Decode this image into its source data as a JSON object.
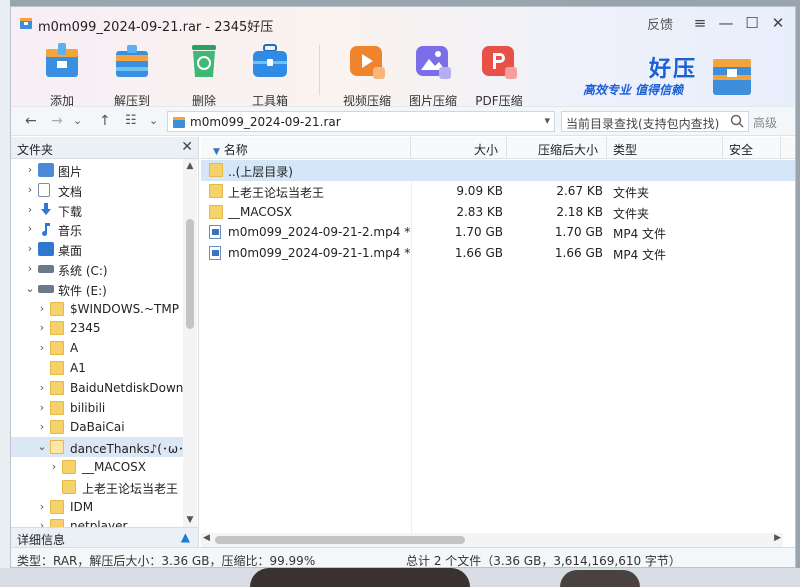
{
  "window": {
    "title": "m0m099_2024-09-21.rar - 2345好压",
    "feedback": "反馈",
    "menu": "≡",
    "minimize": "—",
    "maximize": "☐",
    "close": "✕"
  },
  "toolbar": {
    "items": [
      {
        "label": "添加",
        "color": "#3b8fe0"
      },
      {
        "label": "解压到",
        "color": "#3b8fe0"
      },
      {
        "label": "删除",
        "color": "#3fb874"
      },
      {
        "label": "工具箱",
        "color": "#2f8be6"
      },
      {
        "label": "视频压缩",
        "color": "#f0842c"
      },
      {
        "label": "图片压缩",
        "color": "#7b6ee8"
      },
      {
        "label": "PDF压缩",
        "color": "#e8504a"
      }
    ]
  },
  "brand": {
    "name": "好压",
    "slogan": "高效专业  值得信赖",
    "accent": "#1a5fd6"
  },
  "address": {
    "back": "←",
    "forward": "→",
    "dropdown": "⌄",
    "up": "↑",
    "view": "☷",
    "view_dropdown": "⌄",
    "path": "m0m099_2024-09-21.rar",
    "path_dropdown": "▾",
    "search_placeholder": "当前目录查找(支持包内查找)",
    "advanced": "高级"
  },
  "tree": {
    "header": "文件夹",
    "close": "✕",
    "nodes": [
      {
        "label": "图片",
        "arrow": "›",
        "icon": "pictures"
      },
      {
        "label": "文档",
        "arrow": "›",
        "icon": "documents"
      },
      {
        "label": "下载",
        "arrow": "›",
        "icon": "downloads"
      },
      {
        "label": "音乐",
        "arrow": "›",
        "icon": "music"
      },
      {
        "label": "桌面",
        "arrow": "›",
        "icon": "desktop"
      },
      {
        "label": "系统 (C:)",
        "arrow": "›",
        "icon": "drive"
      },
      {
        "label": "软件 (E:)",
        "arrow": "⌄",
        "icon": "drive"
      },
      {
        "label": "$WINDOWS.~TMP",
        "arrow": "›",
        "icon": "folder"
      },
      {
        "label": "2345",
        "arrow": "›",
        "icon": "folder"
      },
      {
        "label": "A",
        "arrow": "›",
        "icon": "folder"
      },
      {
        "label": "A1",
        "arrow": "",
        "icon": "folder"
      },
      {
        "label": "BaiduNetdiskDownl",
        "arrow": "›",
        "icon": "folder"
      },
      {
        "label": "bilibili",
        "arrow": "›",
        "icon": "folder"
      },
      {
        "label": "DaBaiCai",
        "arrow": "›",
        "icon": "folder"
      },
      {
        "label": "danceThanks♪(･ω･)",
        "arrow": "⌄",
        "icon": "folder-open"
      },
      {
        "label": "__MACOSX",
        "arrow": "›",
        "icon": "folder"
      },
      {
        "label": "上老王论坛当老王",
        "arrow": "",
        "icon": "folder"
      },
      {
        "label": "IDM",
        "arrow": "›",
        "icon": "folder"
      },
      {
        "label": "netplayer",
        "arrow": "›",
        "icon": "folder"
      }
    ],
    "detail_label": "详细信息",
    "detail_toggle": "▲"
  },
  "list": {
    "columns": [
      "名称",
      "大小",
      "压缩后大小",
      "类型",
      "安全"
    ],
    "sort_indicator": "▼",
    "parent_label": "..(上层目录)",
    "rows": [
      {
        "name": "上老王论坛当老王",
        "size": "9.09 KB",
        "packed": "2.67 KB",
        "type": "文件夹",
        "icon": "folder"
      },
      {
        "name": "__MACOSX",
        "size": "2.83 KB",
        "packed": "2.18 KB",
        "type": "文件夹",
        "icon": "folder"
      },
      {
        "name": "m0m099_2024-09-21-2.mp4 *",
        "size": "1.70 GB",
        "packed": "1.70 GB",
        "type": "MP4 文件",
        "icon": "file"
      },
      {
        "name": "m0m099_2024-09-21-1.mp4 *",
        "size": "1.66 GB",
        "packed": "1.66 GB",
        "type": "MP4 文件",
        "icon": "file"
      }
    ]
  },
  "status": {
    "left": "类型：RAR，解压后大小：3.36 GB，压缩比：99.99%",
    "right": "总计 2 个文件（3.36 GB，3,614,169,610 字节）"
  }
}
